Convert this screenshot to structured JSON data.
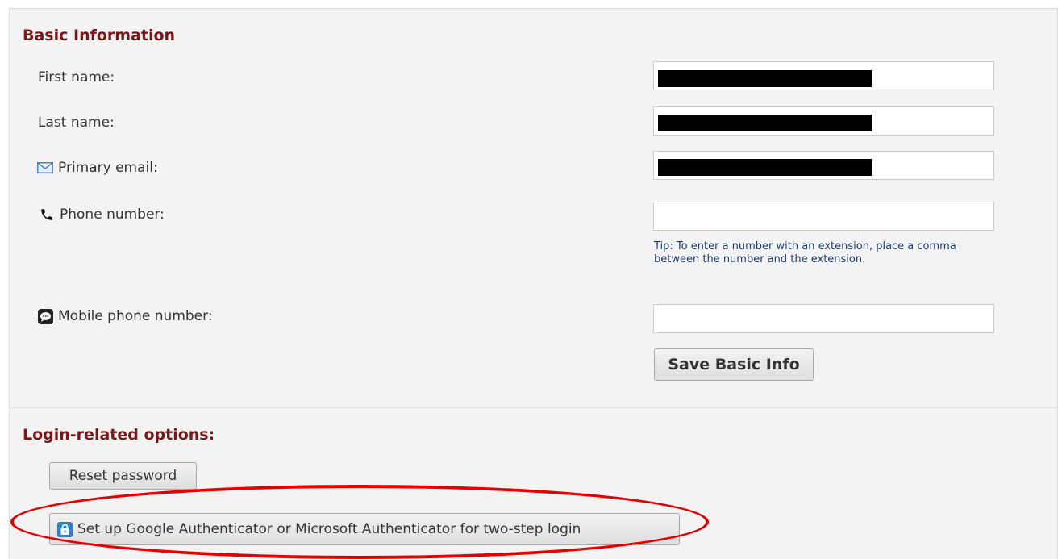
{
  "basic_info": {
    "title": "Basic Information",
    "fields": [
      {
        "label": "First name:",
        "icon": "none",
        "value": ""
      },
      {
        "label": "Last name:",
        "icon": "none",
        "value": ""
      },
      {
        "label": "Primary email:",
        "icon": "envelope-icon",
        "value": ""
      },
      {
        "label": "Phone number:",
        "icon": "phone-icon",
        "value": ""
      },
      {
        "label": "Mobile phone number:",
        "icon": "sms-icon",
        "value": ""
      }
    ],
    "phone_tip": "Tip: To enter a number with an extension, place a comma between the number and the extension.",
    "save_label": "Save Basic Info"
  },
  "login_options": {
    "title": "Login-related options:",
    "reset_label": "Reset password",
    "authenticator_label": "Set up Google Authenticator or Microsoft Authenticator for two-step login",
    "authenticator_icon": "lock-icon"
  },
  "colors": {
    "section_title": "#7a1616",
    "tip_text": "#1f3a6e",
    "highlight_ellipse": "#e60000",
    "lock_icon_bg": "#2a7fd4"
  }
}
